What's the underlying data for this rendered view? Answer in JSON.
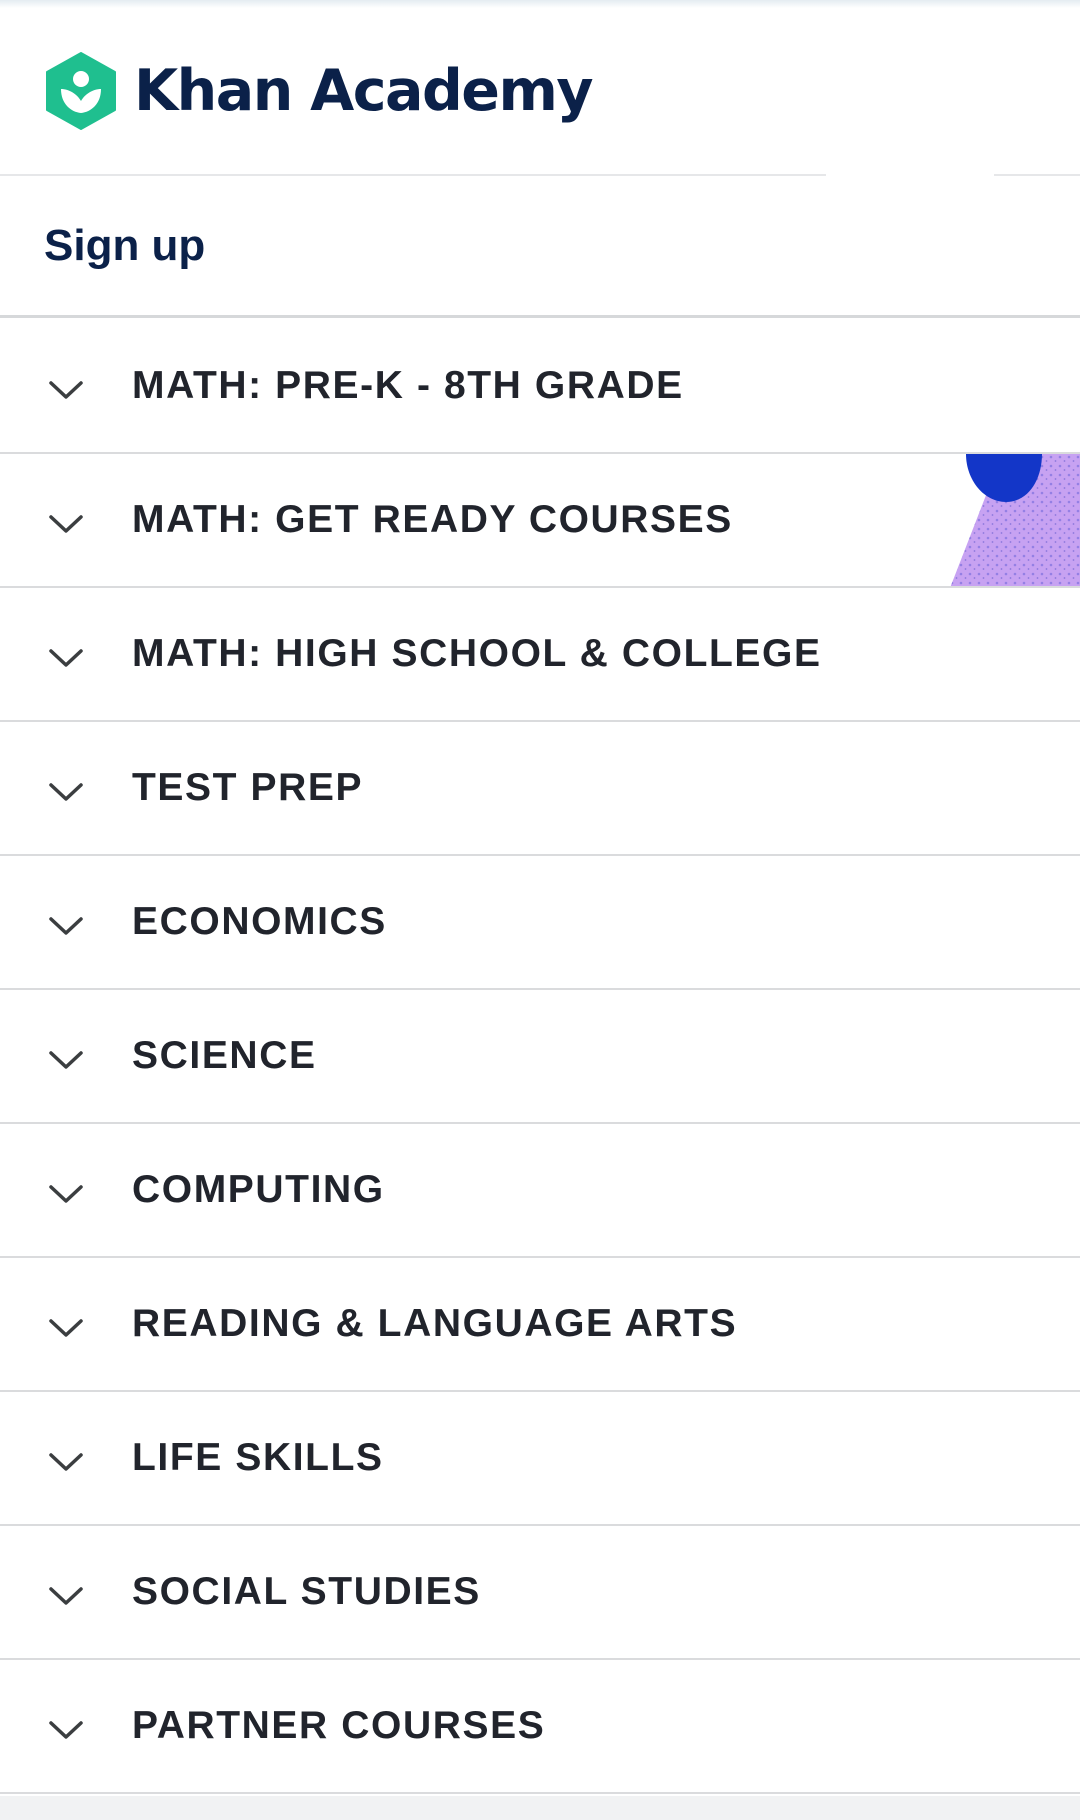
{
  "header": {
    "brand_name": "Khan Academy",
    "brand_color": "#0b2149",
    "logo_color": "#1fbf8f",
    "logo_icon": "khan-leaf-logo"
  },
  "signup": {
    "label": "Sign up"
  },
  "menu": {
    "chevron_icon": "chevron-down-icon",
    "items": [
      {
        "label": "MATH: PRE-K - 8TH GRADE"
      },
      {
        "label": "MATH: GET READY COURSES"
      },
      {
        "label": "MATH: HIGH SCHOOL & COLLEGE"
      },
      {
        "label": "TEST PREP"
      },
      {
        "label": "ECONOMICS"
      },
      {
        "label": "SCIENCE"
      },
      {
        "label": "COMPUTING"
      },
      {
        "label": "READING & LANGUAGE ARTS"
      },
      {
        "label": "LIFE SKILLS"
      },
      {
        "label": "SOCIAL STUDIES"
      },
      {
        "label": "PARTNER COURSES"
      }
    ]
  }
}
